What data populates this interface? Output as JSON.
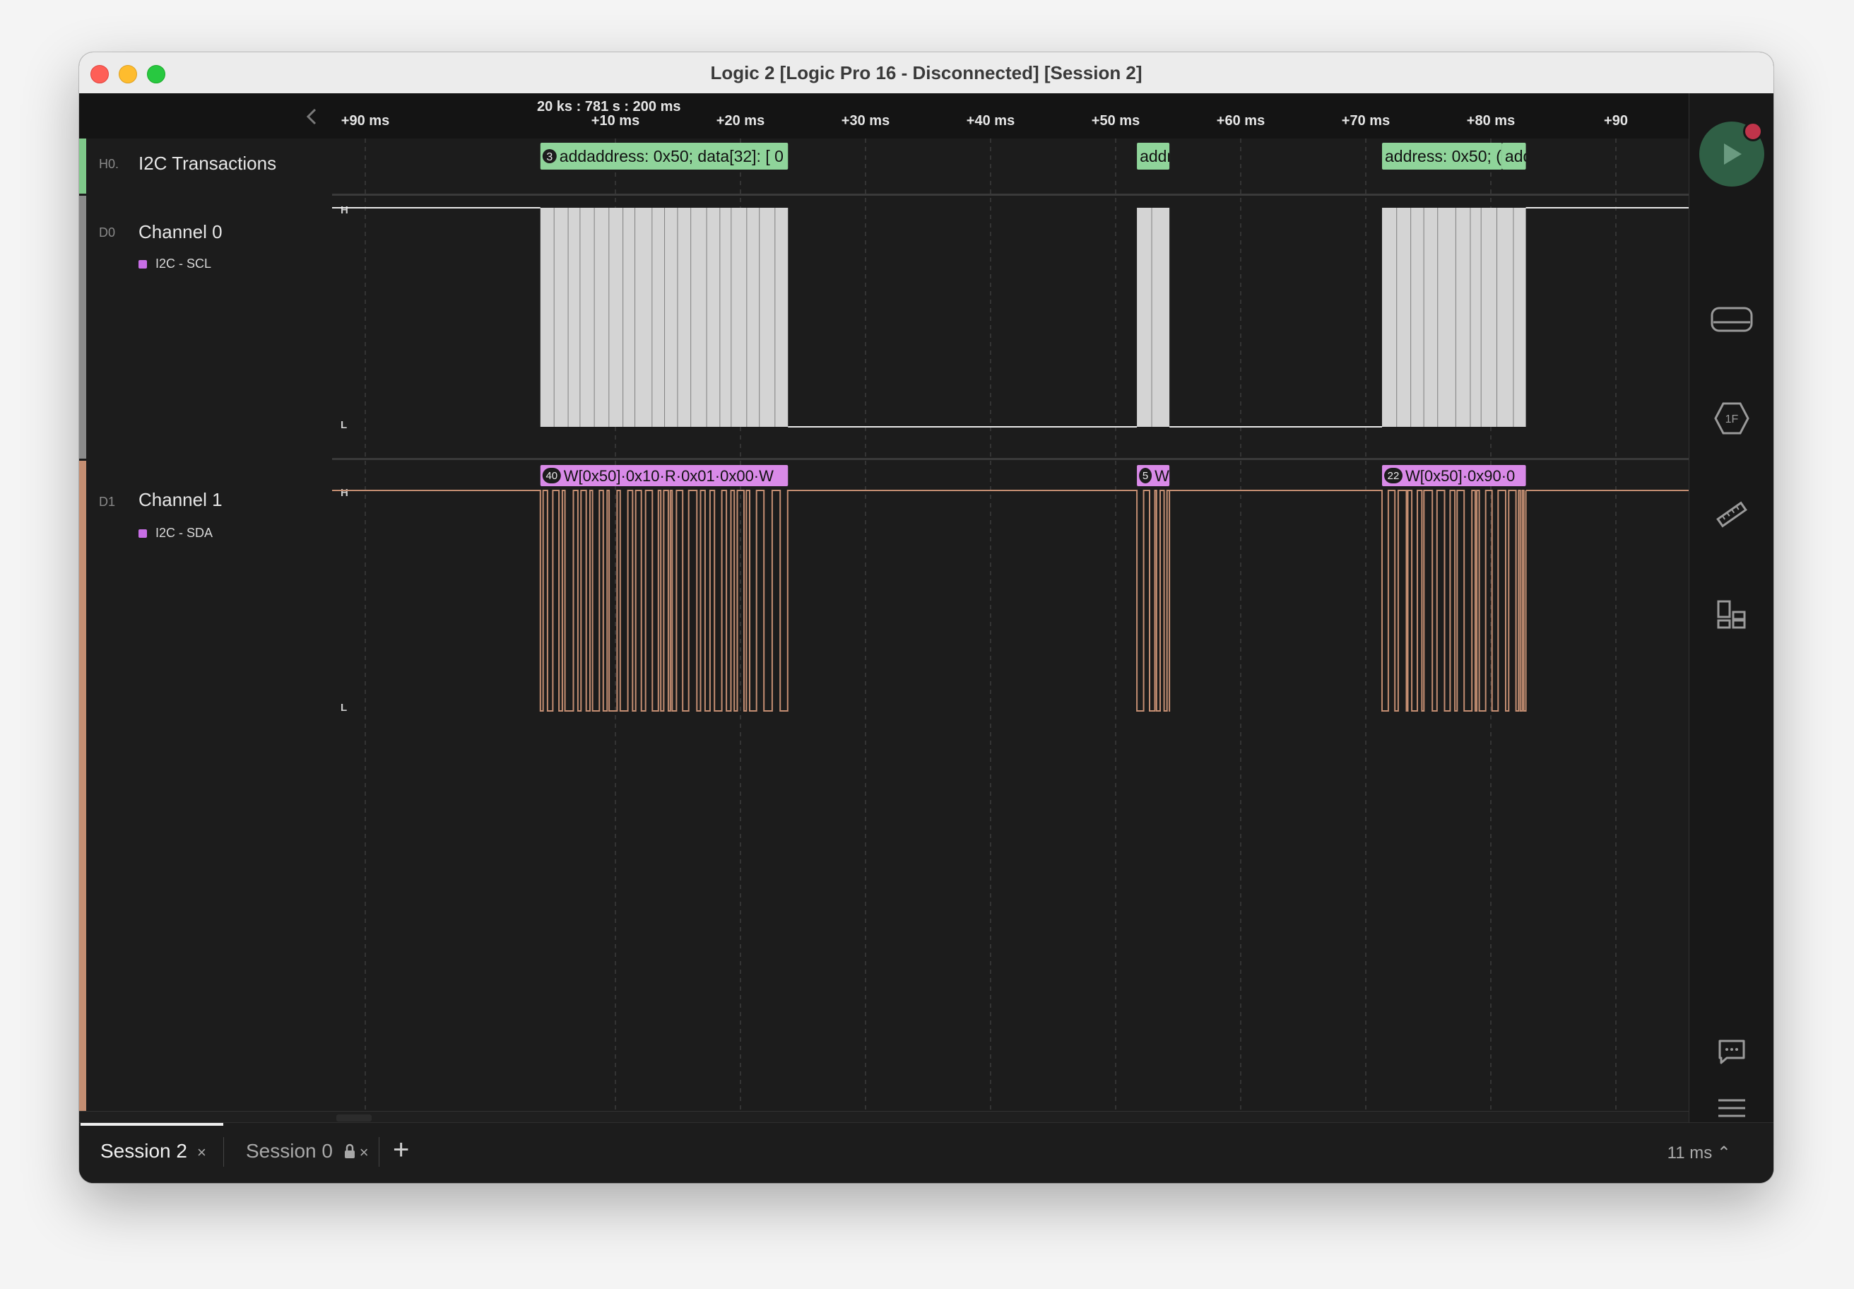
{
  "window": {
    "title": "Logic 2 [Logic Pro 16 - Disconnected] [Session 2]"
  },
  "ruler": {
    "origin": "20 ks : 781 s : 200 ms",
    "ticks": [
      {
        "label": "+90 ms",
        "ms": -10
      },
      {
        "label": "+10 ms",
        "ms": 10
      },
      {
        "label": "+20 ms",
        "ms": 20
      },
      {
        "label": "+30 ms",
        "ms": 30
      },
      {
        "label": "+40 ms",
        "ms": 40
      },
      {
        "label": "+50 ms",
        "ms": 50
      },
      {
        "label": "+60 ms",
        "ms": 60
      },
      {
        "label": "+70 ms",
        "ms": 70
      },
      {
        "label": "+80 ms",
        "ms": 80
      },
      {
        "label": "+90",
        "ms": 90
      }
    ]
  },
  "channels": {
    "analyzer": {
      "id": "H0.",
      "name": "I2C Transactions",
      "color": "#7fc98a"
    },
    "ch0": {
      "id": "D0",
      "name": "Channel 0",
      "analyzer_label": "I2C - SCL",
      "color": "#7a7a7a",
      "high_label": "H",
      "low_label": "L"
    },
    "ch1": {
      "id": "D1",
      "name": "Channel 1",
      "analyzer_label": "I2C - SDA",
      "color": "#c48e72",
      "high_label": "H",
      "low_label": "L"
    }
  },
  "transactions": [
    {
      "count": "3",
      "text": "addaddress: 0x50; data[32]: [ 0",
      "start_ms": 4.0,
      "end_ms": 23.8
    },
    {
      "count": "",
      "text": "addr",
      "start_ms": 51.7,
      "end_ms": 54.3
    },
    {
      "count": "",
      "text": "address: 0x50; (",
      "start_ms": 71.3,
      "end_ms": 80.9
    },
    {
      "count": "",
      "text": "add",
      "start_ms": 80.9,
      "end_ms": 82.8
    }
  ],
  "bursts": [
    {
      "start_ms": 4.0,
      "end_ms": 23.8,
      "sda_label_count": "40",
      "sda_label": "W[0x50]·0x10·R·0x01·0x00·W"
    },
    {
      "start_ms": 51.7,
      "end_ms": 54.3,
      "sda_label_count": "5",
      "sda_label": "W"
    },
    {
      "start_ms": 71.3,
      "end_ms": 82.8,
      "sda_label_count": "22",
      "sda_label": "W[0x50]·0x90·0"
    }
  ],
  "sessions": {
    "tabs": [
      {
        "label": "Session 2",
        "active": true,
        "locked": false
      },
      {
        "label": "Session 0",
        "active": false,
        "locked": true
      }
    ],
    "zoom": "11 ms"
  },
  "icons": {
    "collapse": "chevron-left-icon",
    "play": "play-icon",
    "device": "device-icon",
    "analyzers": "analyzers-hex-icon",
    "measure": "ruler-icon",
    "extensions": "extensions-icon",
    "notes": "chat-icon",
    "menu": "hamburger-icon"
  }
}
